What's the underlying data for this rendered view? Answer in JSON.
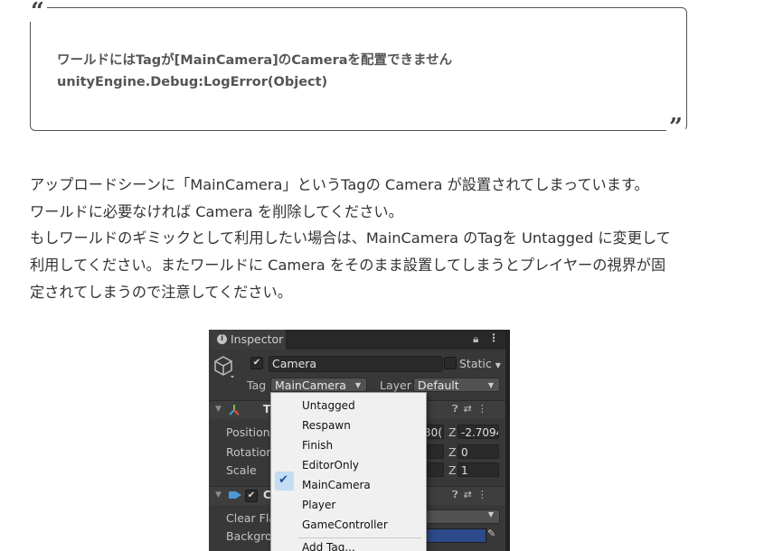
{
  "quote": {
    "open_mark": "“",
    "close_mark": "”",
    "line1": "ワールドにはTagが[MainCamera]のCameraを配置できません",
    "line2": "unityEngine.Debug:LogError(Object)"
  },
  "paragraph": {
    "lines": [
      "アップロードシーンに「MainCamera」というTagの Camera が設置されてしまっています。",
      "ワールドに必要なければ Camera を削除してください。",
      "もしワールドのギミックとして利用したい場合は、MainCamera のTagを Untagged に変更して",
      "利用してください。またワールドに Camera をそのまま設置してしまうとプレイヤーの視界が固",
      "定されてしまうので注意してください。"
    ]
  },
  "inspector": {
    "tab_label": "Inspector",
    "object_name": "Camera",
    "object_enabled": true,
    "static_label": "Static",
    "tag_label": "Tag",
    "tag_value": "MainCamera",
    "layer_label": "Layer",
    "layer_value": "Default",
    "transform": {
      "header_letter": "T",
      "position_label": "Position",
      "rotation_label": "Rotation",
      "scale_label": "Scale",
      "axis_z": "Z",
      "position_x_partial": "30(",
      "position_z": "-2.7094",
      "rotation_z": "0",
      "scale_z": "1"
    },
    "camera_component": {
      "header_letter": "C",
      "enabled": true,
      "clear_flags_label": "Clear Fla",
      "background_label": "Backgrou"
    },
    "tag_menu": {
      "items": [
        "Untagged",
        "Respawn",
        "Finish",
        "EditorOnly",
        "MainCamera",
        "Player",
        "GameController"
      ],
      "selected": "MainCamera",
      "add_tag": "Add Tag..."
    }
  },
  "colors": {
    "inspector_bg": "#383838",
    "menu_bg": "#f0f0f0",
    "selection": "#c5dcf5",
    "text_body": "#333333"
  }
}
